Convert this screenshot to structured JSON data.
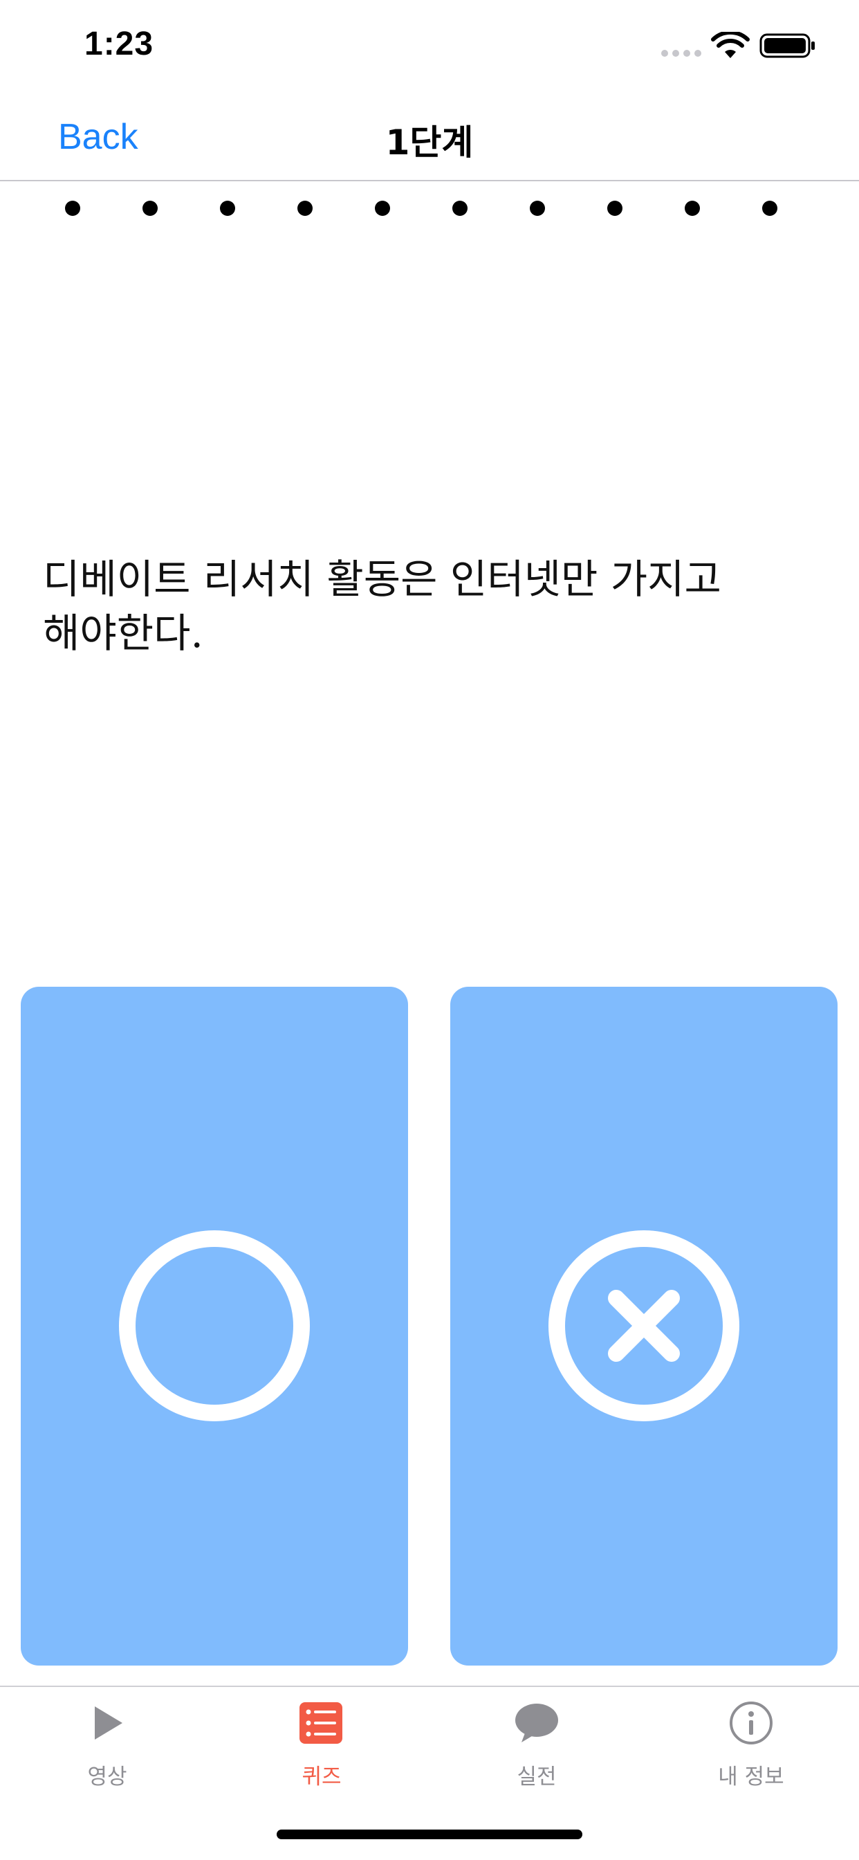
{
  "status_bar": {
    "time": "1:23",
    "icons": [
      "signal-icon",
      "wifi-icon",
      "battery-icon"
    ]
  },
  "nav": {
    "back_label": "Back",
    "title": "1단계"
  },
  "progress": {
    "total_questions": 10
  },
  "question": {
    "text": "디베이트 리서치 활동은 인터넷만 가지고 해야한다."
  },
  "answers": [
    {
      "id": "o",
      "icon": "circle-o-icon"
    },
    {
      "id": "x",
      "icon": "circle-x-icon"
    }
  ],
  "tab_bar": {
    "items": [
      {
        "label": "영상",
        "icon": "play-icon",
        "active": false
      },
      {
        "label": "퀴즈",
        "icon": "list-icon",
        "active": true
      },
      {
        "label": "실전",
        "icon": "chat-bubble-icon",
        "active": false
      },
      {
        "label": "내 정보",
        "icon": "info-icon",
        "active": false
      }
    ]
  },
  "colors": {
    "accent_blue": "#1a82fb",
    "card_blue": "#80bbfd",
    "tab_active": "#f25b45",
    "tab_inactive": "#8e8e93"
  }
}
